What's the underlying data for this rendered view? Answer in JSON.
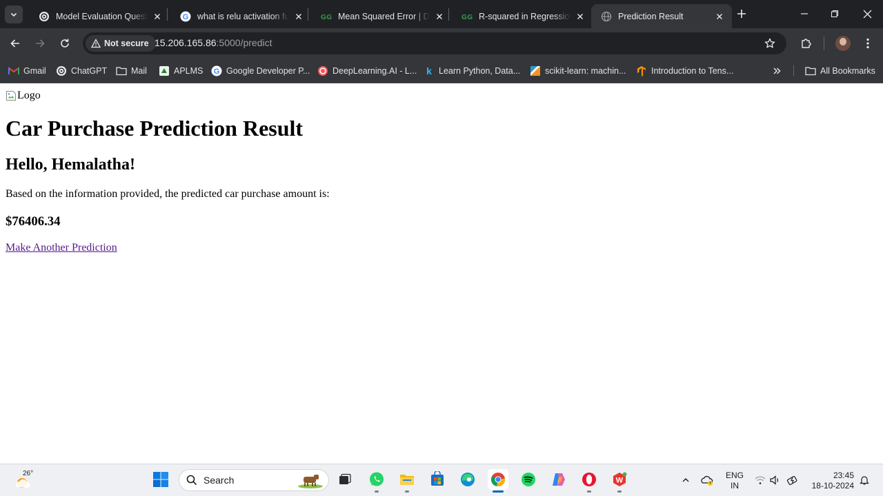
{
  "browser": {
    "tabs": [
      {
        "title": "Model Evaluation Questic",
        "favicon": "chatgpt-icon",
        "active": false
      },
      {
        "title": "what is relu activation fur",
        "favicon": "google-icon",
        "active": false
      },
      {
        "title": "Mean Squared Error | Del",
        "favicon": "geeksforgeeks-icon",
        "active": false
      },
      {
        "title": "R-squared in Regression",
        "favicon": "geeksforgeeks-icon",
        "active": false
      },
      {
        "title": "Prediction Result",
        "favicon": "globe-icon",
        "active": true
      }
    ],
    "security_label": "Not secure",
    "url_host": "15.206.165.86",
    "url_path": ":5000/predict",
    "bookmarks": [
      {
        "label": "Gmail",
        "icon": "gmail-icon"
      },
      {
        "label": "ChatGPT",
        "icon": "chatgpt-icon"
      },
      {
        "label": "Mail",
        "icon": "folder-icon"
      },
      {
        "label": "APLMS",
        "icon": "aplms-icon"
      },
      {
        "label": "Google Developer P...",
        "icon": "google-icon"
      },
      {
        "label": "DeepLearning.AI - L...",
        "icon": "deeplearning-icon"
      },
      {
        "label": "Learn Python, Data...",
        "icon": "kaggle-icon"
      },
      {
        "label": "scikit-learn: machin...",
        "icon": "sklearn-icon"
      },
      {
        "label": "Introduction to Tens...",
        "icon": "tensorflow-icon"
      }
    ],
    "all_bookmarks_label": "All Bookmarks"
  },
  "page": {
    "logo_alt": "Logo",
    "heading": "Car Purchase Prediction Result",
    "greeting": "Hello, Hemalatha!",
    "info_text": "Based on the information provided, the predicted car purchase amount is:",
    "amount": "$76406.34",
    "link_text": "Make Another Prediction"
  },
  "taskbar": {
    "temperature": "26°",
    "search_label": "Search",
    "language_line1": "ENG",
    "language_line2": "IN",
    "time": "23:45",
    "date": "18-10-2024"
  },
  "colors": {
    "tab_strip": "#202124",
    "toolbar": "#35363a",
    "visited_link": "#551a8b",
    "taskbar": "#eef0f4"
  }
}
